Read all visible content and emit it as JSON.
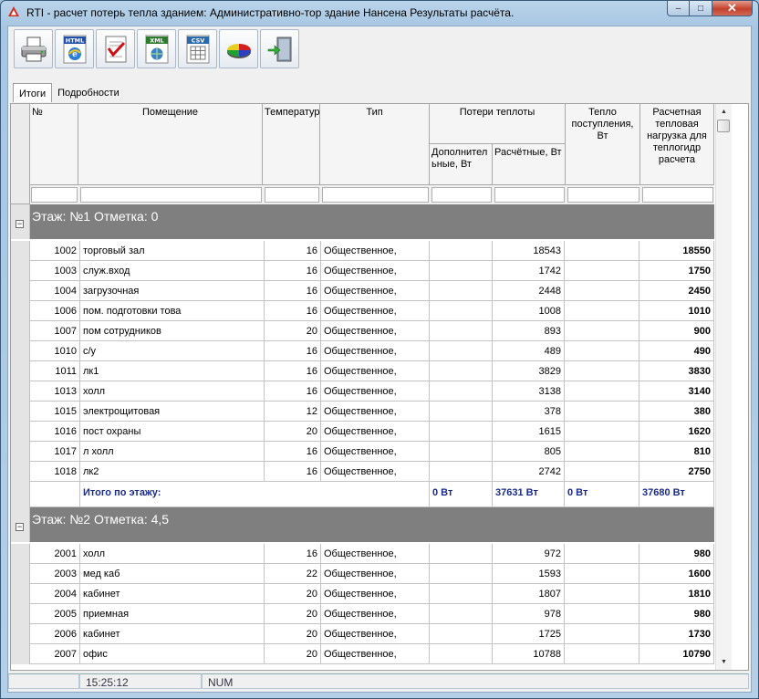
{
  "window": {
    "title": "RTI - расчет потерь тепла зданием: Административно-тор здание Нансена Результаты расчёта.",
    "minimize_glyph": "–",
    "maximize_glyph": "□",
    "close_glyph": "✕"
  },
  "toolbar": {
    "buttons": [
      {
        "name": "print-button",
        "icon": "printer-icon"
      },
      {
        "name": "export-html-button",
        "icon": "html-icon",
        "label": "HTML"
      },
      {
        "name": "export-doc-button",
        "icon": "document-check-icon"
      },
      {
        "name": "export-xml-button",
        "icon": "xml-icon",
        "label": "XML"
      },
      {
        "name": "export-csv-button",
        "icon": "csv-icon",
        "label": "CSV"
      },
      {
        "name": "chart-button",
        "icon": "pie-chart-icon"
      },
      {
        "name": "exit-button",
        "icon": "exit-door-icon"
      }
    ]
  },
  "tabs": [
    "Итоги",
    "Подробности"
  ],
  "table": {
    "headers": {
      "num": "№",
      "room": "Помещение",
      "temp": "Температур",
      "type": "Тип",
      "losses": "Потери теплоты",
      "losses_add": "Дополнител ьные, Вт",
      "losses_calc": "Расчётные, Вт",
      "heat_in": "Тепло поступления, Вт",
      "load": "Расчетная тепловая нагрузка для теплогидр расчета"
    },
    "floors": [
      {
        "label": "Этаж:  №1 Отметка: 0",
        "rows": [
          {
            "num": "1002",
            "room": "торговый зал",
            "temp": "16",
            "type": "Общественное,",
            "add": "",
            "calc": "18543",
            "heat": "",
            "load": "18550"
          },
          {
            "num": "1003",
            "room": "служ.вход",
            "temp": "16",
            "type": "Общественное,",
            "add": "",
            "calc": "1742",
            "heat": "",
            "load": "1750"
          },
          {
            "num": "1004",
            "room": "загрузочная",
            "temp": "16",
            "type": "Общественное,",
            "add": "",
            "calc": "2448",
            "heat": "",
            "load": "2450"
          },
          {
            "num": "1006",
            "room": "пом. подготовки това",
            "temp": "16",
            "type": "Общественное,",
            "add": "",
            "calc": "1008",
            "heat": "",
            "load": "1010"
          },
          {
            "num": "1007",
            "room": "пом сотрудников",
            "temp": "20",
            "type": "Общественное,",
            "add": "",
            "calc": "893",
            "heat": "",
            "load": "900"
          },
          {
            "num": "1010",
            "room": "с/у",
            "temp": "16",
            "type": "Общественное,",
            "add": "",
            "calc": "489",
            "heat": "",
            "load": "490"
          },
          {
            "num": "1011",
            "room": "лк1",
            "temp": "16",
            "type": "Общественное,",
            "add": "",
            "calc": "3829",
            "heat": "",
            "load": "3830"
          },
          {
            "num": "1013",
            "room": "холл",
            "temp": "16",
            "type": "Общественное,",
            "add": "",
            "calc": "3138",
            "heat": "",
            "load": "3140"
          },
          {
            "num": "1015",
            "room": "электрощитовая",
            "temp": "12",
            "type": "Общественное,",
            "add": "",
            "calc": "378",
            "heat": "",
            "load": "380"
          },
          {
            "num": "1016",
            "room": "пост охраны",
            "temp": "20",
            "type": "Общественное,",
            "add": "",
            "calc": "1615",
            "heat": "",
            "load": "1620"
          },
          {
            "num": "1017",
            "room": "л холл",
            "temp": "16",
            "type": "Общественное,",
            "add": "",
            "calc": "805",
            "heat": "",
            "load": "810"
          },
          {
            "num": "1018",
            "room": "лк2",
            "temp": "16",
            "type": "Общественное,",
            "add": "",
            "calc": "2742",
            "heat": "",
            "load": "2750"
          }
        ],
        "total": {
          "label": "Итого по этажу:",
          "add": "0 Вт",
          "calc": "37631 Вт",
          "heat": "0 Вт",
          "load": "37680 Вт"
        }
      },
      {
        "label": "Этаж:  №2 Отметка: 4,5",
        "rows": [
          {
            "num": "2001",
            "room": "холл",
            "temp": "16",
            "type": "Общественное,",
            "add": "",
            "calc": "972",
            "heat": "",
            "load": "980"
          },
          {
            "num": "2003",
            "room": "мед каб",
            "temp": "22",
            "type": "Общественное,",
            "add": "",
            "calc": "1593",
            "heat": "",
            "load": "1600"
          },
          {
            "num": "2004",
            "room": "кабинет",
            "temp": "20",
            "type": "Общественное,",
            "add": "",
            "calc": "1807",
            "heat": "",
            "load": "1810"
          },
          {
            "num": "2005",
            "room": "приемная",
            "temp": "20",
            "type": "Общественное,",
            "add": "",
            "calc": "978",
            "heat": "",
            "load": "980"
          },
          {
            "num": "2006",
            "room": "кабинет",
            "temp": "20",
            "type": "Общественное,",
            "add": "",
            "calc": "1725",
            "heat": "",
            "load": "1730"
          },
          {
            "num": "2007",
            "room": "офис",
            "temp": "20",
            "type": "Общественное,",
            "add": "",
            "calc": "10788",
            "heat": "",
            "load": "10790"
          }
        ]
      }
    ]
  },
  "statusbar": {
    "time": "15:25:12",
    "mode": "NUM"
  },
  "colors": {
    "floor_band": "#7f7f7f",
    "total_text": "#1a2b8a",
    "window_frame": "#a7c6e2"
  }
}
